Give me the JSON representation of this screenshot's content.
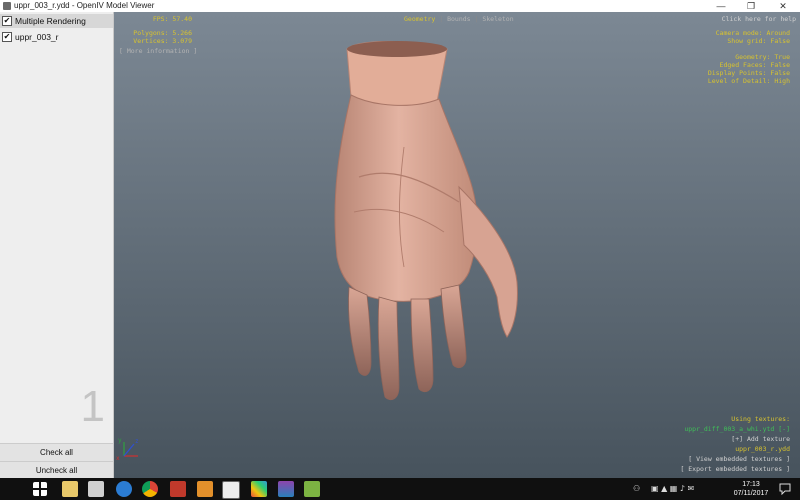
{
  "window": {
    "title": "uppr_003_r.ydd - OpenIV Model Viewer",
    "minimize_glyph": "—",
    "maximize_glyph": "❐",
    "close_glyph": "✕"
  },
  "sidebar": {
    "items": [
      {
        "label": "Multiple Rendering",
        "checked": true
      },
      {
        "label": "uppr_003_r",
        "checked": true
      }
    ],
    "check_glyph": "✔",
    "watermark_number": "1",
    "check_all_label": "Check all",
    "uncheck_all_label": "Uncheck all"
  },
  "hud": {
    "fps": "FPS: 57.40",
    "polygons": "Polygons: 5.266",
    "vertices": "Vertices: 3.079",
    "more_info": "[ More information ]",
    "tabs": [
      "Geometry",
      "Bounds",
      "Skeleton"
    ],
    "tab_separator": "|",
    "help": "Click here for help",
    "camera_mode": "Camera mode: Around",
    "show_grid": "Show grid: False",
    "geometry": "Geometry: True",
    "edged_faces": "Edged Faces: False",
    "display_points": "Display Points: False",
    "level_of_detail": "Level of Detail: High",
    "using_textures": "Using textures:",
    "texture_file": "uppr_diff_003_a_whi.ytd [-]",
    "add_texture": "[+] Add texture",
    "model_file": "uppr_003_r.ydd",
    "view_embedded": "[ View embedded textures ]",
    "export_embedded": "[ Export embedded textures ]",
    "axis_x": "x",
    "axis_y": "y",
    "axis_z": "z"
  },
  "taskbar": {
    "icons": [
      "start-icon",
      "search-icon",
      "file-explorer-icon",
      "store-icon",
      "edge-icon",
      "chrome-icon",
      "app-icon-red",
      "app-icon-orange",
      "openiv-icon",
      "app-icon-colorful",
      "app-icon-tiles",
      "app-icon-green"
    ],
    "time": "17:13",
    "date": "07/11/2017"
  },
  "colors": {
    "hud_yellow": "#d8c32e",
    "hud_green": "#3fbf58",
    "viewport_top": "#7c8894",
    "viewport_bottom": "#47535d"
  }
}
